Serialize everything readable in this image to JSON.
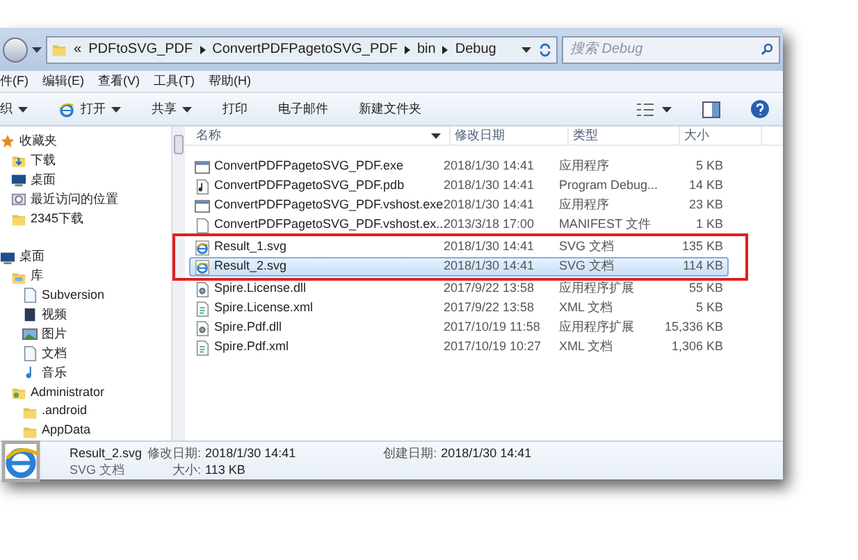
{
  "address_bar": {
    "overflow": "«",
    "crumbs": [
      "PDFtoSVG_PDF",
      "ConvertPDFPagetoSVG_PDF",
      "bin",
      "Debug"
    ]
  },
  "search": {
    "placeholder": "搜索 Debug"
  },
  "menu": [
    "件(F)",
    "编辑(E)",
    "查看(V)",
    "工具(T)",
    "帮助(H)"
  ],
  "toolbar": [
    {
      "label": "织",
      "dropdown": true,
      "icon": false
    },
    {
      "label": "打开",
      "dropdown": true,
      "icon": true
    },
    {
      "label": "共享",
      "dropdown": true,
      "icon": false
    },
    {
      "label": "打印",
      "dropdown": false,
      "icon": false
    },
    {
      "label": "电子邮件",
      "dropdown": false,
      "icon": false
    },
    {
      "label": "新建文件夹",
      "dropdown": false,
      "icon": false
    }
  ],
  "sidebar": {
    "items": [
      {
        "label": "收藏夹",
        "kind": "star",
        "children": [
          {
            "label": "下载",
            "kind": "download"
          },
          {
            "label": "桌面",
            "kind": "desktop"
          },
          {
            "label": "最近访问的位置",
            "kind": "recent"
          },
          {
            "label": "2345下载",
            "kind": "folder"
          }
        ]
      },
      {
        "label": "桌面",
        "kind": "desktop",
        "children": [
          {
            "label": "库",
            "kind": "library",
            "children": [
              {
                "label": "Subversion",
                "kind": "doc"
              },
              {
                "label": "视频",
                "kind": "video"
              },
              {
                "label": "图片",
                "kind": "image"
              },
              {
                "label": "文档",
                "kind": "doc"
              },
              {
                "label": "音乐",
                "kind": "music"
              }
            ]
          },
          {
            "label": "Administrator",
            "kind": "user",
            "children": [
              {
                "label": ".android",
                "kind": "folder"
              },
              {
                "label": "AppData",
                "kind": "folder"
              }
            ]
          }
        ]
      }
    ]
  },
  "table": {
    "columns": [
      "名称",
      "修改日期",
      "类型",
      "大小"
    ],
    "rows": [
      {
        "kind": "exe",
        "name": "ConvertPDFPagetoSVG_PDF.exe",
        "date": "2018/1/30 14:41",
        "type": "应用程序",
        "size": "5 KB",
        "selected": false,
        "highlighted": false
      },
      {
        "kind": "pdb",
        "name": "ConvertPDFPagetoSVG_PDF.pdb",
        "date": "2018/1/30 14:41",
        "type": "Program Debug...",
        "size": "14 KB",
        "selected": false,
        "highlighted": false
      },
      {
        "kind": "exe",
        "name": "ConvertPDFPagetoSVG_PDF.vshost.exe",
        "date": "2018/1/30 14:41",
        "type": "应用程序",
        "size": "23 KB",
        "selected": false,
        "highlighted": false
      },
      {
        "kind": "blank",
        "name": "ConvertPDFPagetoSVG_PDF.vshost.ex...",
        "date": "2013/3/18 17:00",
        "type": "MANIFEST 文件",
        "size": "1 KB",
        "selected": false,
        "highlighted": false
      },
      {
        "kind": "svg",
        "name": "Result_1.svg",
        "date": "2018/1/30 14:41",
        "type": "SVG 文档",
        "size": "135 KB",
        "selected": false,
        "highlighted": true
      },
      {
        "kind": "svg",
        "name": "Result_2.svg",
        "date": "2018/1/30 14:41",
        "type": "SVG 文档",
        "size": "114 KB",
        "selected": true,
        "highlighted": true
      },
      {
        "kind": "dll",
        "name": "Spire.License.dll",
        "date": "2017/9/22 13:58",
        "type": "应用程序扩展",
        "size": "55 KB",
        "selected": false,
        "highlighted": false
      },
      {
        "kind": "xml",
        "name": "Spire.License.xml",
        "date": "2017/9/22 13:58",
        "type": "XML 文档",
        "size": "5 KB",
        "selected": false,
        "highlighted": false
      },
      {
        "kind": "dll",
        "name": "Spire.Pdf.dll",
        "date": "2017/10/19 11:58",
        "type": "应用程序扩展",
        "size": "15,336 KB",
        "selected": false,
        "highlighted": false
      },
      {
        "kind": "xml",
        "name": "Spire.Pdf.xml",
        "date": "2017/10/19 10:27",
        "type": "XML 文档",
        "size": "1,306 KB",
        "selected": false,
        "highlighted": false
      }
    ]
  },
  "details": {
    "name": "Result_2.svg",
    "type": "SVG 文档",
    "fields": [
      {
        "label": "修改日期:",
        "value": "2018/1/30 14:41"
      },
      {
        "label": "创建日期:",
        "value": "2018/1/30 14:41"
      },
      {
        "label": "大小:",
        "value": "113 KB"
      }
    ]
  }
}
